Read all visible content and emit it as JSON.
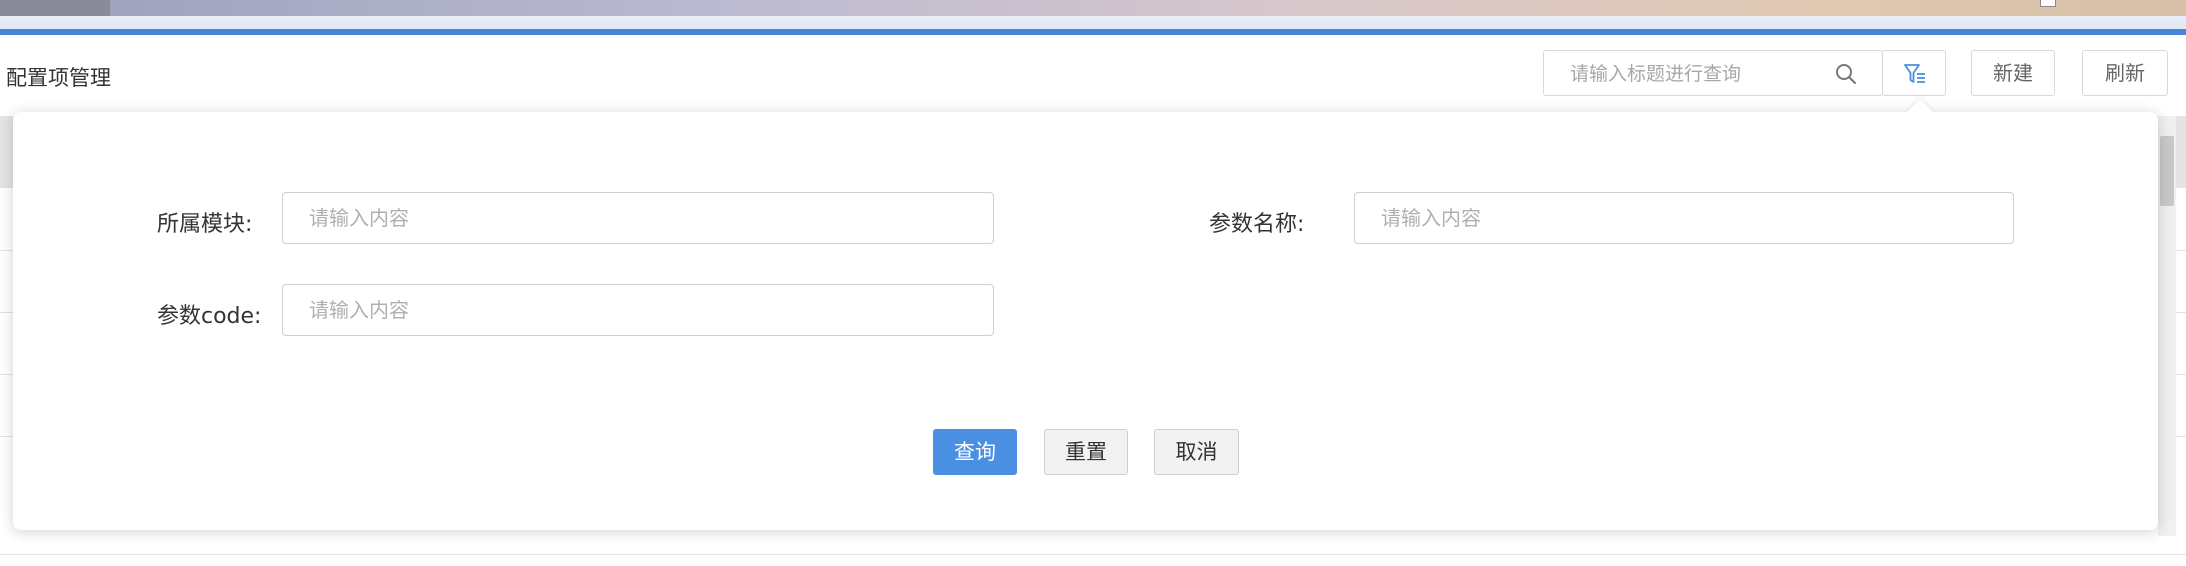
{
  "page": {
    "title": "配置项管理"
  },
  "toolbar": {
    "search_placeholder": "请输入标题进行查询",
    "new_label": "新建",
    "refresh_label": "刷新",
    "accent_color": "#4a90e2"
  },
  "filter": {
    "module_label": "所属模块:",
    "module_placeholder": "请输入内容",
    "param_name_label": "参数名称:",
    "param_name_placeholder": "请输入内容",
    "param_code_label": "参数code:",
    "param_code_placeholder": "请输入内容",
    "query_label": "查询",
    "reset_label": "重置",
    "cancel_label": "取消"
  },
  "icons": {
    "search": "search-icon",
    "filter": "filter-icon"
  }
}
